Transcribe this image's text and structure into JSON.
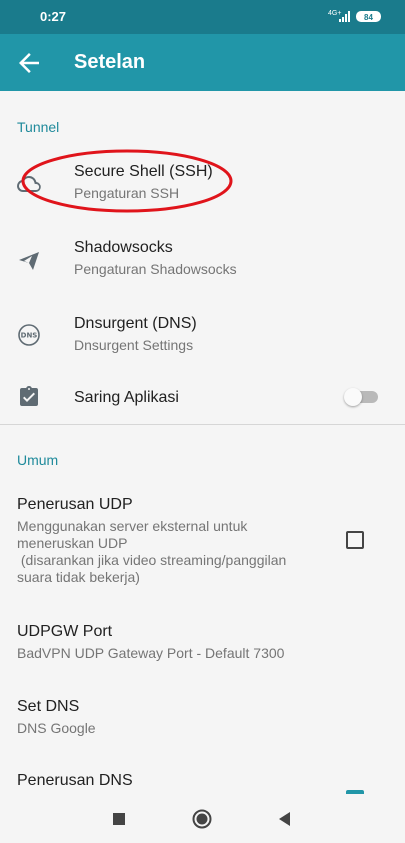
{
  "status_bar": {
    "time": "0:27",
    "network": "4G+",
    "battery": "84"
  },
  "app_bar": {
    "title": "Setelan",
    "back_icon": "arrow-left-icon"
  },
  "sections": {
    "tunnel": {
      "header": "Tunnel",
      "items": [
        {
          "title": "Secure Shell (SSH)",
          "subtitle": "Pengaturan SSH",
          "icon": "cloud-icon"
        },
        {
          "title": "Shadowsocks",
          "subtitle": "Pengaturan Shadowsocks",
          "icon": "paper-plane-icon"
        },
        {
          "title": "Dnsurgent (DNS)",
          "subtitle": "Dnsurgent Settings",
          "icon": "dns-icon"
        },
        {
          "title": "Saring Aplikasi",
          "icon": "clipboard-check-icon",
          "toggle": false
        }
      ]
    },
    "umum": {
      "header": "Umum",
      "items": [
        {
          "title": "Penerusan UDP",
          "subtitle_lines": [
            "Menggunakan server eksternal untuk",
            "meneruskan UDP",
            " (disarankan jika video streaming/panggilan",
            "suara tidak bekerja)"
          ],
          "checkbox": false
        },
        {
          "title": "UDPGW Port",
          "subtitle": "BadVPN UDP Gateway Port - Default 7300"
        },
        {
          "title": "Set DNS",
          "subtitle": "DNS Google"
        },
        {
          "title": "Penerusan DNS",
          "checkbox": true
        }
      ]
    }
  },
  "annotation": {
    "shape": "red-ellipse",
    "color": "#e0141b"
  },
  "nav_bar": {
    "icons": [
      "recents-square-icon",
      "home-circle-icon",
      "back-triangle-icon"
    ]
  },
  "colors": {
    "status_bar": "#1a7b8c",
    "app_bar": "#2196a8",
    "section_header": "#1f8a9b",
    "background": "#f5f5f5"
  }
}
